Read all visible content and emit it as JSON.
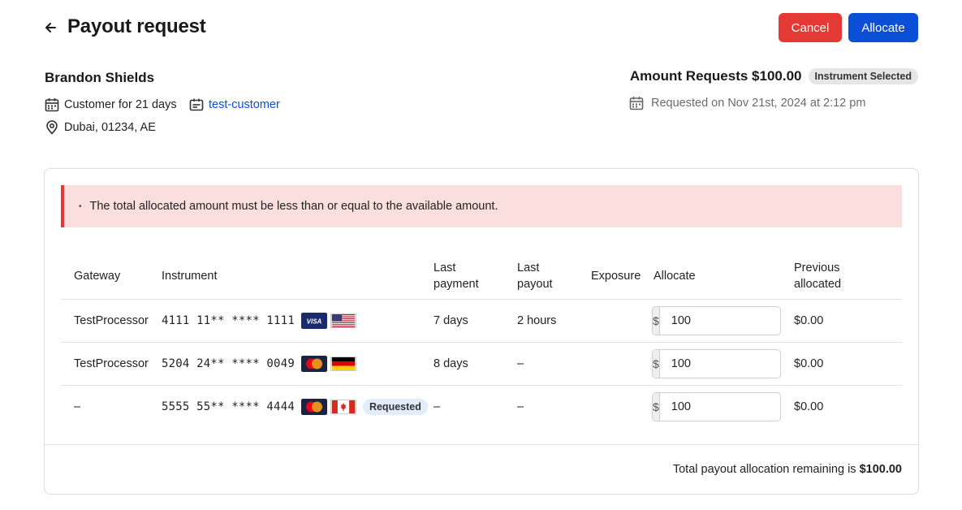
{
  "header": {
    "title": "Payout request",
    "cancel_label": "Cancel",
    "allocate_label": "Allocate",
    "back_icon": "arrow-left-icon"
  },
  "customer": {
    "name": "Brandon Shields",
    "customer_for": "Customer for 21 days",
    "tag": "test-customer",
    "location": "Dubai, 01234, AE"
  },
  "request": {
    "amount_title": "Amount Requests $100.00",
    "status_badge": "Instrument Selected",
    "requested_on": "Requested on Nov 21st, 2024 at 2:12 pm"
  },
  "alert": {
    "message": "The total allocated amount must be less than or equal to the available amount.",
    "color": "#e53935"
  },
  "table": {
    "headers": {
      "gateway": "Gateway",
      "instrument": "Instrument",
      "last_payment_1": "Last",
      "last_payment_2": "payment",
      "last_payout_1": "Last",
      "last_payout_2": "payout",
      "exposure": "Exposure",
      "allocate": "Allocate",
      "previous_1": "Previous",
      "previous_2": "allocated"
    },
    "rows": [
      {
        "gateway": "TestProcessor",
        "instrument": "4111 11** **** 1111",
        "card_brand": "VISA",
        "flag": "us-flag-icon",
        "requested": "",
        "last_payment": "7 days",
        "last_payout": "2 hours",
        "exposure": "",
        "currency": "$",
        "allocate": "100",
        "previous": "$0.00"
      },
      {
        "gateway": "TestProcessor",
        "instrument": "5204 24** **** 0049",
        "card_brand": "MasterCard",
        "flag": "de-flag-icon",
        "requested": "",
        "last_payment": "8 days",
        "last_payout": "–",
        "exposure": "",
        "currency": "$",
        "allocate": "100",
        "previous": "$0.00"
      },
      {
        "gateway": "–",
        "instrument": "5555 55** **** 4444",
        "card_brand": "MasterCard",
        "flag": "ca-flag-icon",
        "requested": "Requested",
        "last_payment": "–",
        "last_payout": "–",
        "exposure": "",
        "currency": "$",
        "allocate": "100",
        "previous": "$0.00"
      }
    ]
  },
  "footer": {
    "remaining_label": "Total payout allocation remaining is ",
    "remaining_value": "$100.00"
  },
  "colors": {
    "primary": "#0b4fd6",
    "danger": "#e53935",
    "alert_bg": "#fbdfdf"
  }
}
